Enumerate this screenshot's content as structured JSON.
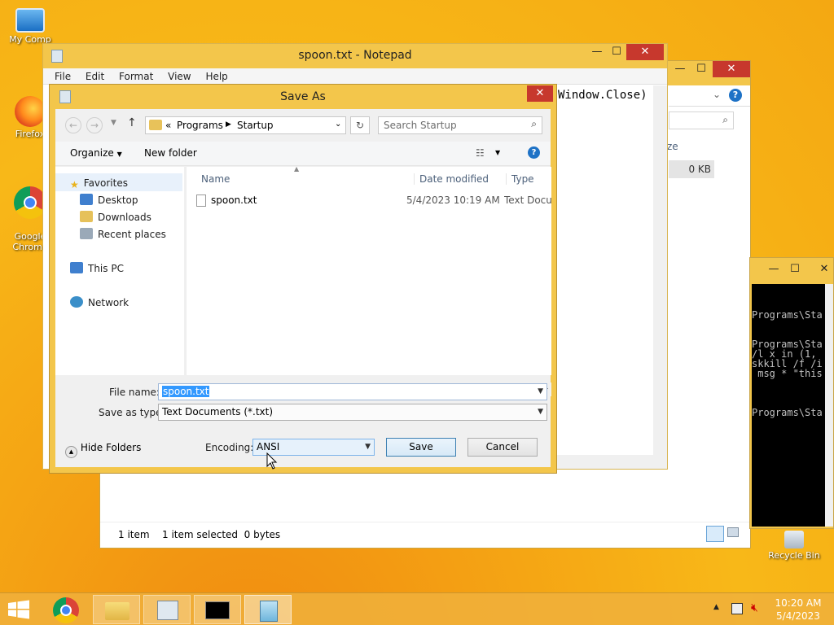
{
  "desktop": {
    "icons": [
      {
        "label": "My Comp"
      },
      {
        "label": "Firefox"
      },
      {
        "label": "Google\nChrome"
      },
      {
        "label": "Recycle Bin"
      }
    ]
  },
  "notepad": {
    "title": "spoon.txt - Notepad",
    "menu": [
      "File",
      "Edit",
      "Format",
      "View",
      "Help"
    ],
    "text_fragment": "Window.Close)"
  },
  "explorer": {
    "size_header": "ze",
    "size_value": "0 KB",
    "status_items": "1 item",
    "status_selected": "1 item selected  0 bytes"
  },
  "cmd": {
    "lines": [
      "Programs\\Sta",
      "",
      "",
      "Programs\\Sta",
      "/l x in (1,",
      "skkill /f /i",
      " msg * \"this",
      "",
      "",
      "",
      "Programs\\Sta"
    ]
  },
  "dialog": {
    "title": "Save As",
    "breadcrumb": {
      "prefix": "«",
      "items": [
        "Programs",
        "Startup"
      ]
    },
    "search_placeholder": "Search Startup",
    "toolbar": {
      "organize": "Organize",
      "new_folder": "New folder"
    },
    "nav": {
      "favorites": "Favorites",
      "desktop": "Desktop",
      "downloads": "Downloads",
      "recent": "Recent places",
      "this_pc": "This PC",
      "network": "Network"
    },
    "columns": {
      "name": "Name",
      "date": "Date modified",
      "type": "Type"
    },
    "files": [
      {
        "name": "spoon.txt",
        "date": "5/4/2023 10:19 AM",
        "type": "Text Docu"
      }
    ],
    "file_name_label": "File name:",
    "file_name_value": "spoon.txt",
    "save_type_label": "Save as type:",
    "save_type_value": "Text Documents (*.txt)",
    "hide_folders": "Hide Folders",
    "encoding_label": "Encoding:",
    "encoding_value": "ANSI",
    "save_label": "Save",
    "cancel_label": "Cancel"
  },
  "clock": {
    "time": "10:20 AM",
    "date": "5/4/2023"
  }
}
